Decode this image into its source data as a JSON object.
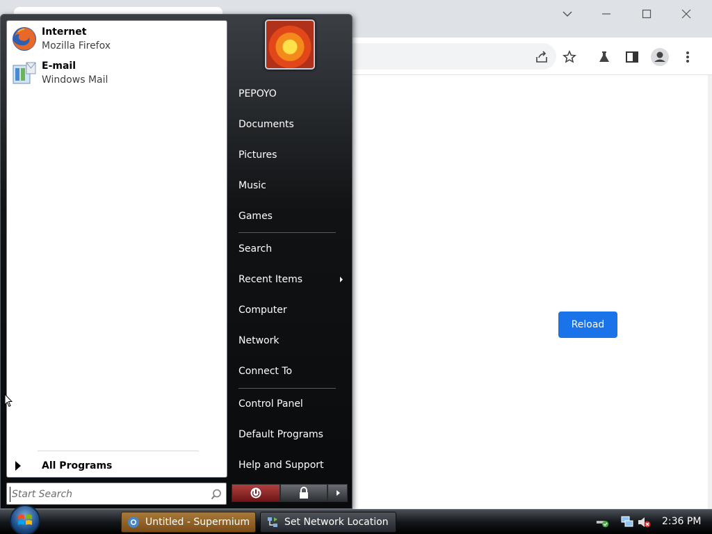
{
  "browser": {
    "reload_label": "Reload"
  },
  "start_menu": {
    "pinned": [
      {
        "title": "Internet",
        "subtitle": "Mozilla Firefox",
        "icon": "firefox-icon"
      },
      {
        "title": "E-mail",
        "subtitle": "Windows Mail",
        "icon": "windows-mail-icon"
      }
    ],
    "all_programs_label": "All Programs",
    "search": {
      "placeholder": "Start Search"
    },
    "right_items": [
      {
        "label": "PEPOYO"
      },
      {
        "label": "Documents"
      },
      {
        "label": "Pictures"
      },
      {
        "label": "Music"
      },
      {
        "label": "Games"
      },
      {
        "label": "Search"
      },
      {
        "label": "Recent Items"
      },
      {
        "label": "Computer"
      },
      {
        "label": "Network"
      },
      {
        "label": "Connect To"
      },
      {
        "label": "Control Panel"
      },
      {
        "label": "Default Programs"
      },
      {
        "label": "Help and Support"
      }
    ]
  },
  "taskbar": {
    "tasks": [
      {
        "label": "Untitled - Supermium",
        "icon": "supermium-icon",
        "active": true
      },
      {
        "label": "Set Network Location",
        "icon": "network-location-icon",
        "active": false
      }
    ],
    "clock": "2:36 PM"
  },
  "colors": {
    "accent": "#1a73e8",
    "start_menu_bg": "#101214",
    "taskbar_active": "#a87a3a"
  }
}
